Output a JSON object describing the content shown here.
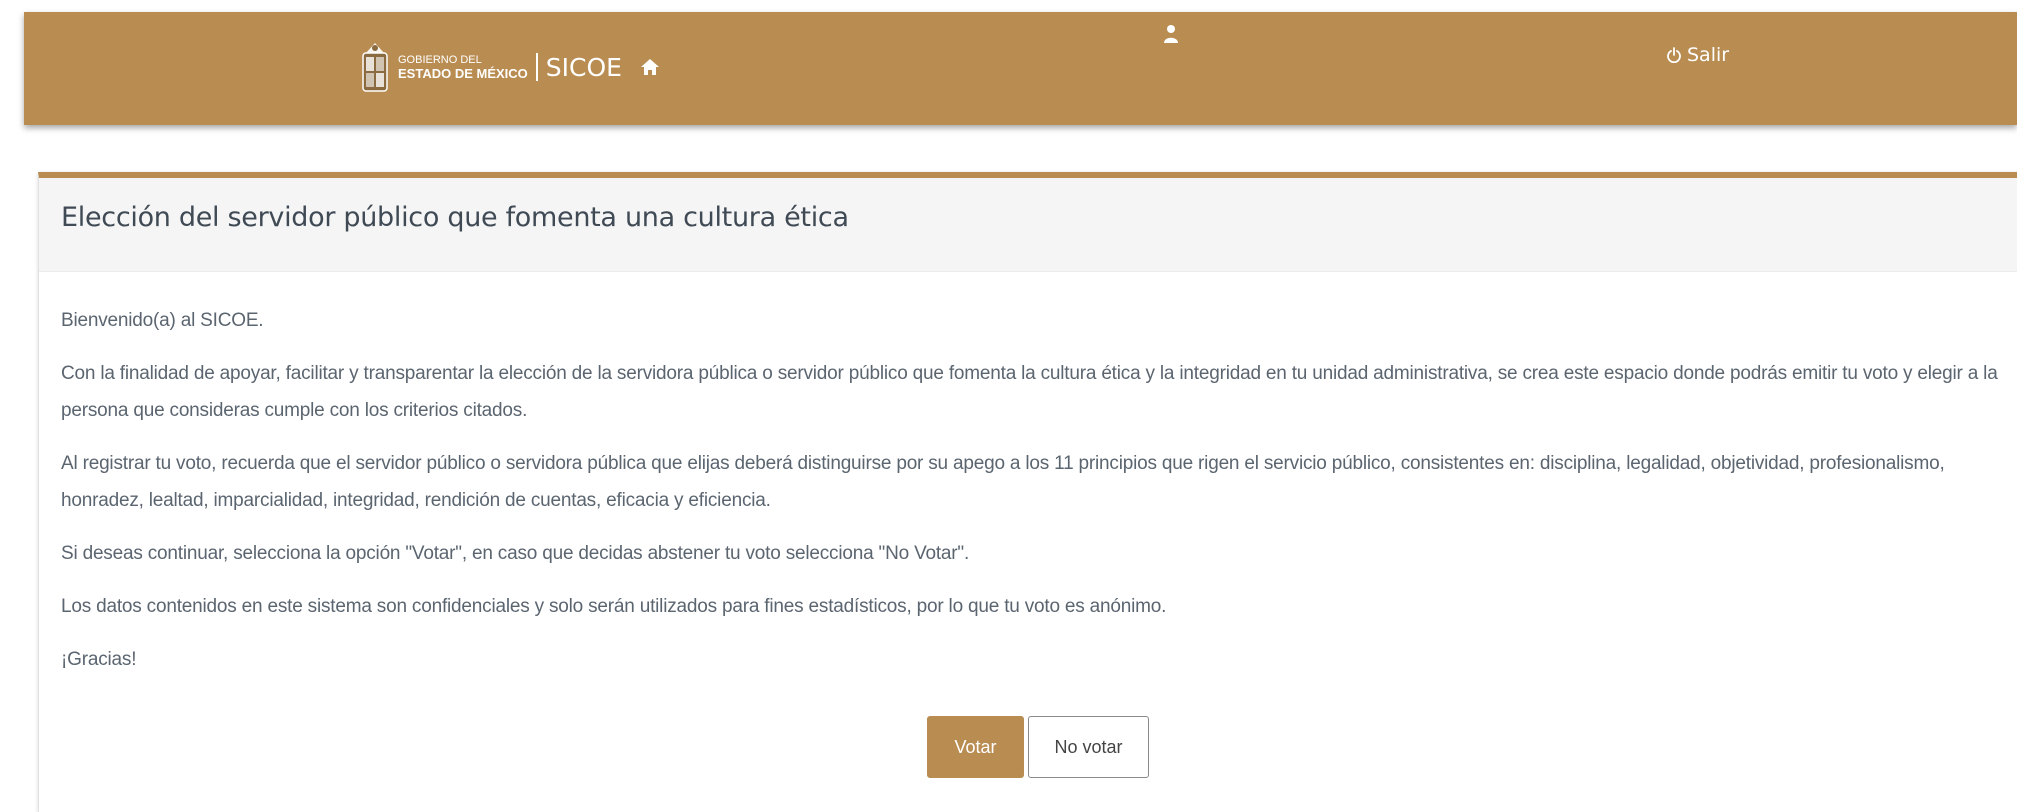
{
  "header": {
    "gov_line1": "GOBIERNO DEL",
    "gov_line2": "ESTADO DE MÉXICO",
    "app_name": "SICOE",
    "home_icon": "home-icon",
    "user_icon": "user-icon",
    "logout_label": "Salir",
    "logout_icon": "power-icon",
    "bar_color": "#b98d52"
  },
  "panel": {
    "title": "Elección del servidor público que fomenta una cultura ética",
    "paragraphs": [
      "Bienvenido(a) al SICOE.",
      "Con la finalidad de apoyar, facilitar y transparentar la elección de la servidora pública o servidor público que fomenta la cultura ética y la integridad en tu unidad administrativa, se crea este espacio donde podrás emitir tu voto y elegir a la persona que consideras cumple con los criterios citados.",
      "Al registrar tu voto, recuerda que el servidor público o servidora pública que elijas deberá distinguirse por su apego a los 11 principios que rigen el servicio público, consistentes en: disciplina, legalidad, objetividad, profesionalismo, honradez, lealtad, imparcialidad, integridad, rendición de cuentas, eficacia y eficiencia.",
      "Si deseas continuar, selecciona la opción \"Votar\", en caso que decidas abstener tu voto selecciona \"No Votar\".",
      "Los datos contenidos en este sistema son confidenciales y solo serán utilizados para fines estadísticos, por lo que tu voto es anónimo.",
      "¡Gracias!"
    ],
    "vote_label": "Votar",
    "no_vote_label": "No votar",
    "accent_color": "#b98d52"
  }
}
